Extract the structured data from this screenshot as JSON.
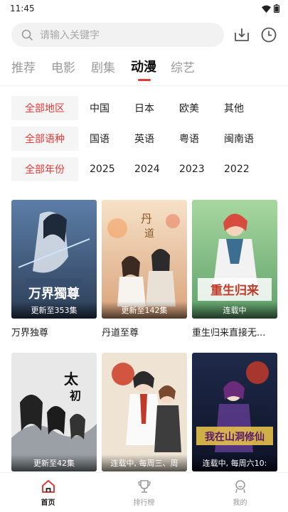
{
  "status_bar": {
    "time": "11:45"
  },
  "search": {
    "placeholder": "请输入关键字"
  },
  "top_icons": [
    "download-icon",
    "history-icon"
  ],
  "tabs": [
    {
      "label": "推荐",
      "active": false
    },
    {
      "label": "电影",
      "active": false
    },
    {
      "label": "剧集",
      "active": false
    },
    {
      "label": "动漫",
      "active": true
    },
    {
      "label": "综艺",
      "active": false
    }
  ],
  "filters": {
    "region": {
      "label": "全部地区",
      "options": [
        "中国",
        "日本",
        "欧美",
        "其他"
      ]
    },
    "language": {
      "label": "全部语种",
      "options": [
        "国语",
        "英语",
        "粤语",
        "闽南语"
      ]
    },
    "year": {
      "label": "全部年份",
      "options": [
        "2025",
        "2024",
        "2023",
        "2022"
      ]
    }
  },
  "cards": [
    {
      "title": "万界独尊",
      "badge": "更新至353集"
    },
    {
      "title": "丹道至尊",
      "badge": "更新至142集"
    },
    {
      "title": "重生归来直接无...",
      "badge": "连载中"
    },
    {
      "title": "",
      "badge": "更新至42集"
    },
    {
      "title": "",
      "badge": "连载中, 每周三、周"
    },
    {
      "title": "",
      "badge": "连载中, 每周六10:"
    }
  ],
  "bottom_nav": [
    {
      "label": "首页",
      "icon": "home-icon",
      "active": true
    },
    {
      "label": "排行榜",
      "icon": "trophy-icon",
      "active": false
    },
    {
      "label": "我的",
      "icon": "profile-icon",
      "active": false
    }
  ],
  "colors": {
    "accent": "#e53935",
    "chip_bg": "#f5f5f5",
    "muted": "#9a9a9a"
  }
}
